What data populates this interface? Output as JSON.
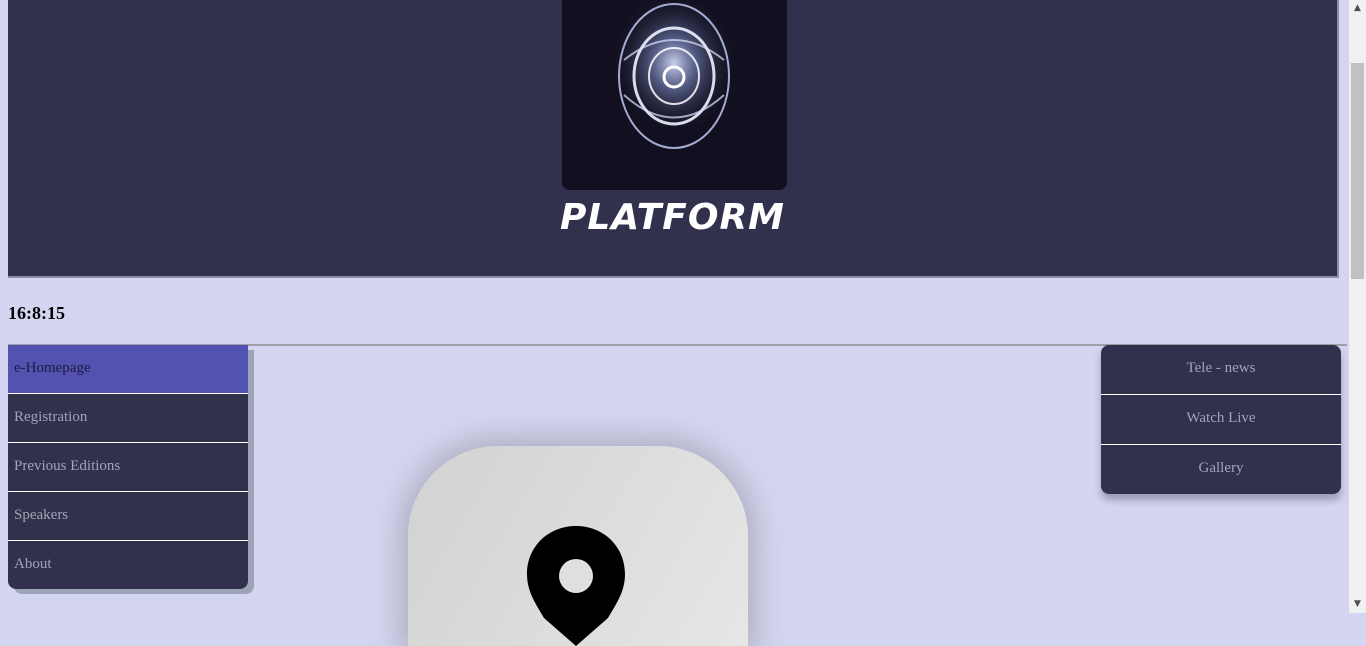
{
  "header": {
    "title": "PLATFORM"
  },
  "clock": {
    "time": "16:8:15"
  },
  "left_nav": {
    "items": [
      {
        "label": "e-Homepage",
        "active": true
      },
      {
        "label": "Registration"
      },
      {
        "label": "Previous Editions"
      },
      {
        "label": "Speakers"
      },
      {
        "label": "About"
      }
    ]
  },
  "right_nav": {
    "items": [
      {
        "label": "Tele - news"
      },
      {
        "label": "Watch Live"
      },
      {
        "label": "Gallery"
      }
    ]
  },
  "colors": {
    "header_bg": "#31304d",
    "page_bg": "#d4d6f1",
    "active_nav": "#5452b1"
  },
  "icons": {
    "logo": "energy-orb-icon",
    "map": "map-pin-icon"
  }
}
